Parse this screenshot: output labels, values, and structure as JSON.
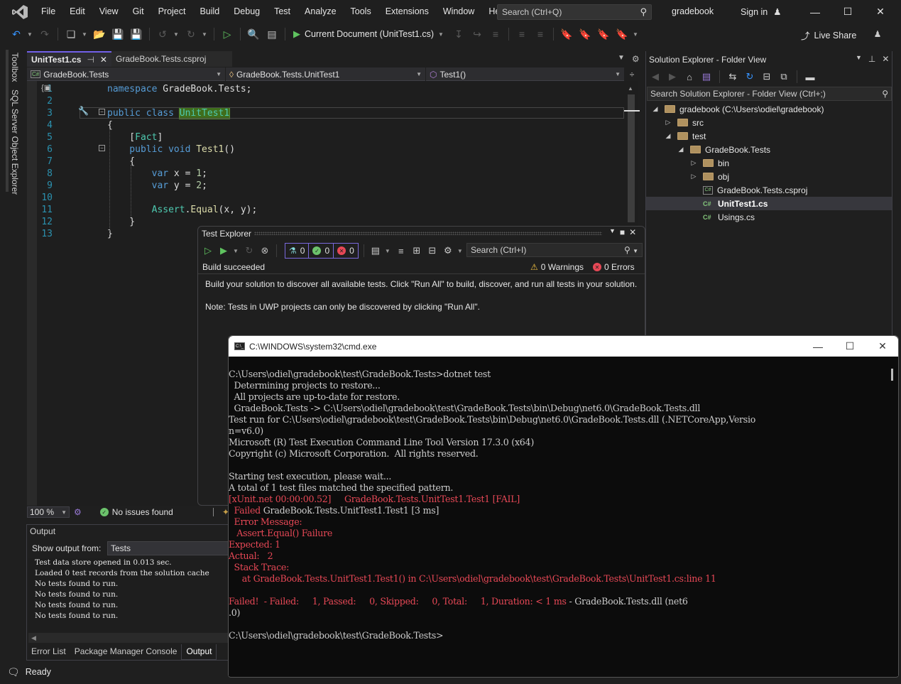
{
  "app": {
    "menu": [
      "File",
      "Edit",
      "View",
      "Git",
      "Project",
      "Build",
      "Debug",
      "Test",
      "Analyze",
      "Tools",
      "Extensions",
      "Window",
      "Help"
    ],
    "search_placeholder": "Search (Ctrl+Q)",
    "solution_name": "gradebook",
    "sign_in": "Sign in",
    "run_target": "Current Document (UnitTest1.cs)",
    "live_share": "Live Share"
  },
  "left_rail": {
    "tabs": [
      "Toolbox",
      "SQL Server Object Explorer"
    ]
  },
  "editor": {
    "tabs": [
      {
        "label": "UnitTest1.cs",
        "active": true
      },
      {
        "label": "GradeBook.Tests.csproj",
        "active": false
      }
    ],
    "nav": {
      "project": "GradeBook.Tests",
      "type": "GradeBook.Tests.UnitTest1",
      "member": "Test1()"
    },
    "lines": [
      {
        "n": "1",
        "tokens": [
          [
            "kw",
            "namespace "
          ],
          [
            "tx",
            "GradeBook.Tests;"
          ]
        ]
      },
      {
        "n": "2",
        "tokens": []
      },
      {
        "n": "3",
        "tokens": [
          [
            "kw",
            "public class "
          ],
          [
            "hl",
            "UnitTest1"
          ]
        ]
      },
      {
        "n": "4",
        "tokens": [
          [
            "tx",
            "{"
          ]
        ]
      },
      {
        "n": "5",
        "tokens": [
          [
            "tx",
            "    ["
          ],
          [
            "ty",
            "Fact"
          ],
          [
            "tx",
            "]"
          ]
        ]
      },
      {
        "n": "6",
        "tokens": [
          [
            "kw",
            "    public void "
          ],
          [
            "fn",
            "Test1"
          ],
          [
            "tx",
            "()"
          ]
        ]
      },
      {
        "n": "7",
        "tokens": [
          [
            "tx",
            "    {"
          ]
        ]
      },
      {
        "n": "8",
        "tokens": [
          [
            "kw",
            "        var "
          ],
          [
            "tx",
            "x = "
          ],
          [
            "nm",
            "1"
          ],
          [
            "tx",
            ";"
          ]
        ]
      },
      {
        "n": "9",
        "tokens": [
          [
            "kw",
            "        var "
          ],
          [
            "tx",
            "y = "
          ],
          [
            "nm",
            "2"
          ],
          [
            "tx",
            ";"
          ]
        ]
      },
      {
        "n": "10",
        "tokens": []
      },
      {
        "n": "11",
        "tokens": [
          [
            "ty",
            "        Assert"
          ],
          [
            "tx",
            "."
          ],
          [
            "fn",
            "Equal"
          ],
          [
            "tx",
            "(x, y);"
          ]
        ]
      },
      {
        "n": "12",
        "tokens": [
          [
            "tx",
            "    }"
          ]
        ]
      },
      {
        "n": "13",
        "tokens": [
          [
            "tx",
            "}"
          ]
        ]
      }
    ],
    "zoom": "100 %",
    "issues": "No issues found"
  },
  "output": {
    "title": "Output",
    "show_from_label": "Show output from:",
    "show_from_value": "Tests",
    "lines": [
      "Test data store opened in 0.013 sec.",
      "Loaded 0 test records from the solution cache",
      "No tests found to run.",
      "No tests found to run.",
      "No tests found to run.",
      "No tests found to run."
    ],
    "tabs": [
      {
        "label": "Error List",
        "active": false
      },
      {
        "label": "Package Manager Console",
        "active": false
      },
      {
        "label": "Output",
        "active": true
      }
    ]
  },
  "status_bar": {
    "text": "Ready"
  },
  "solution_explorer": {
    "title": "Solution Explorer - Folder View",
    "search_placeholder": "Search Solution Explorer - Folder View (Ctrl+;)",
    "tree": [
      {
        "label": "gradebook (C:\\Users\\odiel\\gradebook)",
        "depth": 0,
        "kind": "folder",
        "expander": "expanded"
      },
      {
        "label": "src",
        "depth": 1,
        "kind": "folder",
        "expander": "collapsed"
      },
      {
        "label": "test",
        "depth": 1,
        "kind": "folder",
        "expander": "expanded"
      },
      {
        "label": "GradeBook.Tests",
        "depth": 2,
        "kind": "folder",
        "expander": "expanded"
      },
      {
        "label": "bin",
        "depth": 3,
        "kind": "folder",
        "expander": "collapsed"
      },
      {
        "label": "obj",
        "depth": 3,
        "kind": "folder",
        "expander": "collapsed"
      },
      {
        "label": "GradeBook.Tests.csproj",
        "depth": 3,
        "kind": "csproj",
        "expander": "none"
      },
      {
        "label": "UnitTest1.cs",
        "depth": 3,
        "kind": "cs",
        "expander": "none",
        "selected": true
      },
      {
        "label": "Usings.cs",
        "depth": 3,
        "kind": "cs",
        "expander": "none"
      }
    ]
  },
  "test_explorer": {
    "title": "Test Explorer",
    "counts": {
      "total": "0",
      "passed": "0",
      "failed": "0"
    },
    "search_placeholder": "Search (Ctrl+I)",
    "build_status": "Build succeeded",
    "warnings": "0 Warnings",
    "errors": "0 Errors",
    "message1": "Build your solution to discover all available tests. Click \"Run All\" to build, discover, and run all tests in your solution.",
    "message2": "Note: Tests in UWP projects can only be discovered by clicking \"Run All\"."
  },
  "cmd": {
    "title": "C:\\WINDOWS\\system32\\cmd.exe",
    "lines": [
      {
        "segs": [
          [
            "n",
            "C:\\Users\\odiel\\gradebook\\test\\GradeBook.Tests>dotnet test"
          ]
        ]
      },
      {
        "segs": [
          [
            "n",
            "  Determining projects to restore..."
          ]
        ]
      },
      {
        "segs": [
          [
            "n",
            "  All projects are up-to-date for restore."
          ]
        ]
      },
      {
        "segs": [
          [
            "n",
            "  GradeBook.Tests -> C:\\Users\\odiel\\gradebook\\test\\GradeBook.Tests\\bin\\Debug\\net6.0\\GradeBook.Tests.dll"
          ]
        ]
      },
      {
        "segs": [
          [
            "n",
            "Test run for C:\\Users\\odiel\\gradebook\\test\\GradeBook.Tests\\bin\\Debug\\net6.0\\GradeBook.Tests.dll (.NETCoreApp,Versio"
          ]
        ]
      },
      {
        "segs": [
          [
            "n",
            "n=v6.0)"
          ]
        ]
      },
      {
        "segs": [
          [
            "n",
            "Microsoft (R) Test Execution Command Line Tool Version 17.3.0 (x64)"
          ]
        ]
      },
      {
        "segs": [
          [
            "n",
            "Copyright (c) Microsoft Corporation.  All rights reserved."
          ]
        ]
      },
      {
        "segs": [
          [
            "n",
            ""
          ]
        ]
      },
      {
        "segs": [
          [
            "n",
            "Starting test execution, please wait..."
          ]
        ]
      },
      {
        "segs": [
          [
            "n",
            "A total of 1 test files matched the specified pattern."
          ]
        ]
      },
      {
        "segs": [
          [
            "r",
            "[xUnit.net 00:00:00.52]     GradeBook.Tests.UnitTest1.Test1 [FAIL]"
          ]
        ]
      },
      {
        "segs": [
          [
            "r",
            "  Failed "
          ],
          [
            "n",
            "GradeBook.Tests.UnitTest1.Test1 [3 ms]"
          ]
        ]
      },
      {
        "segs": [
          [
            "r",
            "  Error Message:"
          ]
        ]
      },
      {
        "segs": [
          [
            "r",
            "   Assert.Equal() Failure"
          ]
        ]
      },
      {
        "segs": [
          [
            "r",
            "Expected: 1"
          ]
        ]
      },
      {
        "segs": [
          [
            "r",
            "Actual:   2"
          ]
        ]
      },
      {
        "segs": [
          [
            "r",
            "  Stack Trace:"
          ]
        ]
      },
      {
        "segs": [
          [
            "r",
            "     at GradeBook.Tests.UnitTest1.Test1() in C:\\Users\\odiel\\gradebook\\test\\GradeBook.Tests\\UnitTest1.cs:line 11"
          ]
        ]
      },
      {
        "segs": [
          [
            "n",
            ""
          ]
        ]
      },
      {
        "segs": [
          [
            "r",
            "Failed!  - Failed:     1, Passed:     0, Skipped:     0, Total:     1, Duration: < 1 ms"
          ],
          [
            "n",
            " - GradeBook.Tests.dll (net6"
          ]
        ]
      },
      {
        "segs": [
          [
            "n",
            ".0)"
          ]
        ]
      },
      {
        "segs": [
          [
            "n",
            ""
          ]
        ]
      },
      {
        "segs": [
          [
            "n",
            "C:\\Users\\odiel\\gradebook\\test\\GradeBook.Tests>"
          ]
        ]
      }
    ]
  },
  "colors": {
    "accent": "#7160e8",
    "error_red": "#e74856",
    "success_green": "#6cc36c"
  }
}
